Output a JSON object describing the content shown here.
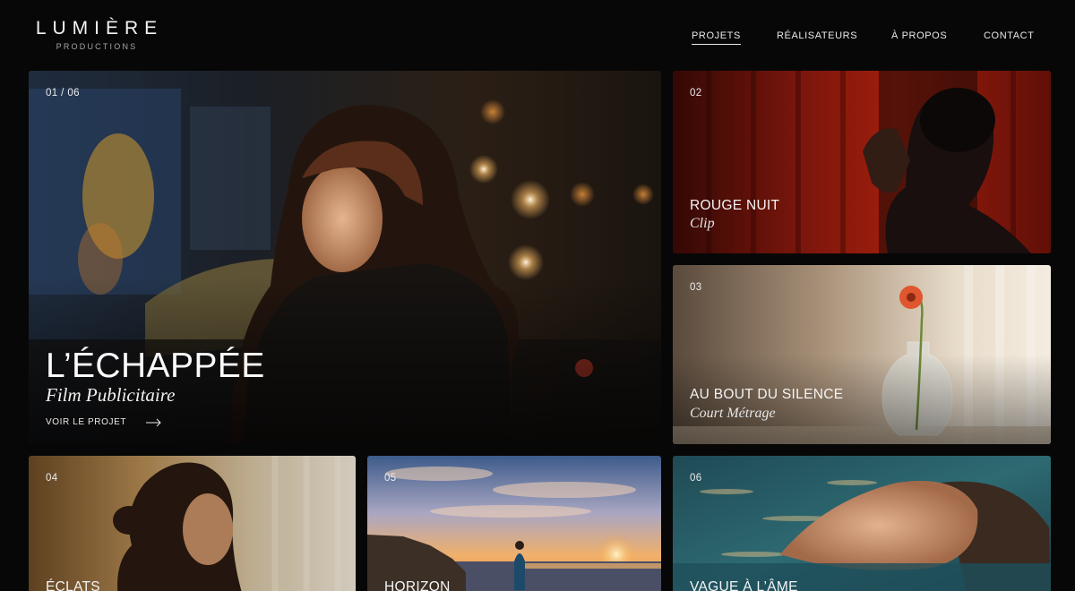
{
  "brand": {
    "name": "LUMIÈRE",
    "tagline": "PRODUCTIONS"
  },
  "nav": {
    "items": [
      {
        "label": "PROJETS",
        "active": true
      },
      {
        "label": "RÉALISATEURS",
        "active": false
      },
      {
        "label": "À PROPOS",
        "active": false
      },
      {
        "label": "CONTACT",
        "active": false
      }
    ]
  },
  "featured": {
    "counter": "01 / 06",
    "title": "L’ÉCHAPPÉE",
    "category": "Film Publicitaire",
    "link_label": "VOIR LE PROJET",
    "link_icon": "arrow-right-icon"
  },
  "projects": [
    {
      "number": "02",
      "title": "ROUGE NUIT",
      "category": "Clip"
    },
    {
      "number": "03",
      "title": "AU BOUT DU SILENCE",
      "category": "Court Métrage"
    },
    {
      "number": "04",
      "title": "ÉCLATS",
      "category": ""
    },
    {
      "number": "05",
      "title": "HORIZON",
      "category": ""
    },
    {
      "number": "06",
      "title": "VAGUE À L’ÂME",
      "category": ""
    }
  ]
}
